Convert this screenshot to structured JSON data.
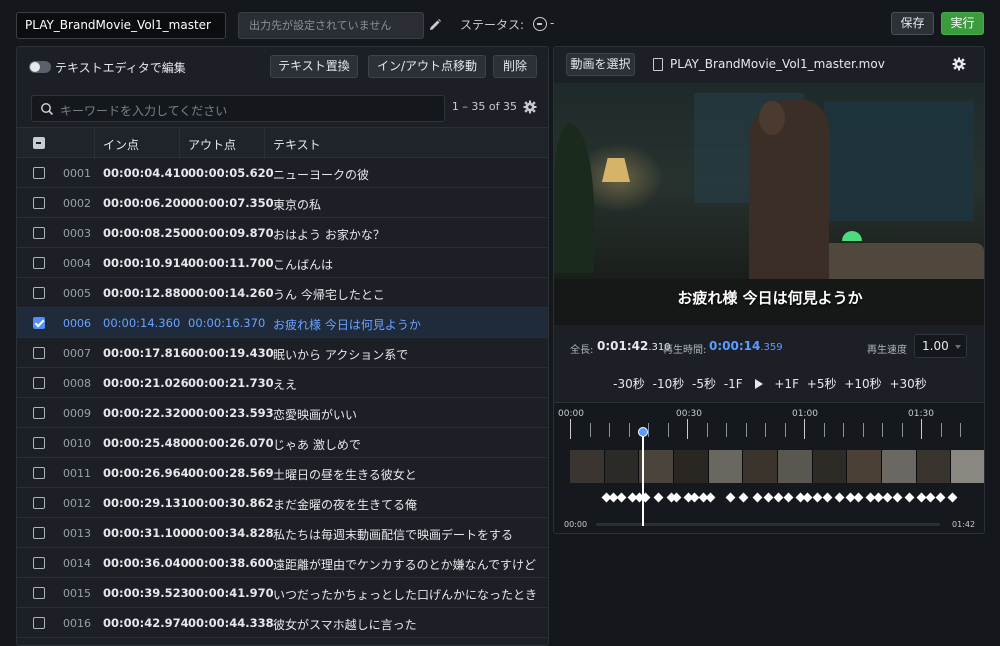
{
  "header": {
    "project_name": "PLAY_BrandMovie_Vol1_master",
    "output_placeholder": "出力先が設定されていません",
    "status_label": "ステータス:",
    "status_value": "-",
    "save_label": "保存",
    "run_label": "実行"
  },
  "editor": {
    "toggle_label": "テキストエディタで編集",
    "toggle_on": false,
    "replace_label": "テキスト置換",
    "inout_move_label": "イン/アウト点移動",
    "delete_label": "削除",
    "search_placeholder": "キーワードを入力してください",
    "count_text": "1 – 35 of 35",
    "columns": {
      "in": "イン点",
      "out": "アウト点",
      "text": "テキスト"
    },
    "rows": [
      {
        "num": "0001",
        "in": "00:00:04.410",
        "out": "00:00:05.620",
        "text": "ニューヨークの彼",
        "selected": false
      },
      {
        "num": "0002",
        "in": "00:00:06.200",
        "out": "00:00:07.350",
        "text": "東京の私",
        "selected": false
      },
      {
        "num": "0003",
        "in": "00:00:08.250",
        "out": "00:00:09.870",
        "text": "おはよう お家かな？",
        "selected": false
      },
      {
        "num": "0004",
        "in": "00:00:10.914",
        "out": "00:00:11.700",
        "text": "こんばんは",
        "selected": false
      },
      {
        "num": "0005",
        "in": "00:00:12.880",
        "out": "00:00:14.260",
        "text": "うん 今帰宅したとこ",
        "selected": false
      },
      {
        "num": "0006",
        "in": "00:00:14.360",
        "out": "00:00:16.370",
        "text": "お疲れ様 今日は何見ようか",
        "selected": true
      },
      {
        "num": "0007",
        "in": "00:00:17.816",
        "out": "00:00:19.430",
        "text": "眠いから アクション系で",
        "selected": false
      },
      {
        "num": "0008",
        "in": "00:00:21.026",
        "out": "00:00:21.730",
        "text": "ええ",
        "selected": false
      },
      {
        "num": "0009",
        "in": "00:00:22.320",
        "out": "00:00:23.593",
        "text": "恋愛映画がいい",
        "selected": false
      },
      {
        "num": "0010",
        "in": "00:00:25.480",
        "out": "00:00:26.070",
        "text": "じゃあ 激しめで",
        "selected": false
      },
      {
        "num": "0011",
        "in": "00:00:26.964",
        "out": "00:00:28.569",
        "text": "土曜日の昼を生きる彼女と",
        "selected": false
      },
      {
        "num": "0012",
        "in": "00:00:29.131",
        "out": "00:00:30.862",
        "text": "まだ金曜の夜を生きてる俺",
        "selected": false
      },
      {
        "num": "0013",
        "in": "00:00:31.100",
        "out": "00:00:34.828",
        "text": "私たちは毎週末動画配信で映画デートをする",
        "selected": false
      },
      {
        "num": "0014",
        "in": "00:00:36.040",
        "out": "00:00:38.600",
        "text": "遠距離が理由でケンカするのとか嫌なんですけど",
        "selected": false
      },
      {
        "num": "0015",
        "in": "00:00:39.523",
        "out": "00:00:41.970",
        "text": "いつだったかちょっとした口げんかになったとき",
        "selected": false
      },
      {
        "num": "0016",
        "in": "00:00:42.974",
        "out": "00:00:44.338",
        "text": "彼女がスマホ越しに言った",
        "selected": false
      }
    ]
  },
  "player": {
    "select_video_label": "動画を選択",
    "filename": "PLAY_BrandMovie_Vol1_master.mov",
    "subtitle": "お疲れ様 今日は何見ようか",
    "total_label": "全長:",
    "total_main": "0:01:42",
    "total_ms": ".310",
    "current_label": "再生時間:",
    "current_main": "0:00:14",
    "current_ms": ".359",
    "speed_label": "再生速度",
    "speed_value": "1.00",
    "jumps_back": [
      "-30秒",
      "-10秒",
      "-5秒",
      "-1F"
    ],
    "jumps_fwd": [
      "+1F",
      "+5秒",
      "+10秒",
      "+30秒"
    ],
    "timeline_labels": [
      "00:00",
      "00:30",
      "01:00",
      "01:30"
    ],
    "scroll_start": "00:00",
    "scroll_end": "01:42",
    "playhead_seconds": 14.359,
    "total_seconds": 102.31
  },
  "colors": {
    "accent_blue": "#4f8ff7",
    "run_green": "#3c9a3f",
    "selected_text": "#6aa3ff"
  }
}
